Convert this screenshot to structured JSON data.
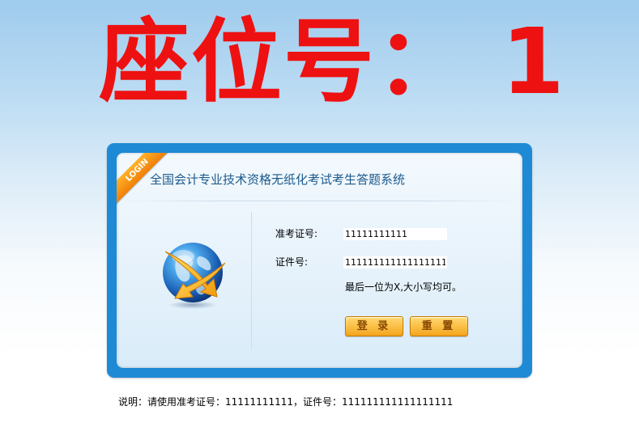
{
  "seat_title": "座位号： 1",
  "panel": {
    "ribbon_label": "LOGIN",
    "system_title": "全国会计专业技术资格无纸化考试考生答题系统",
    "exam_no_label": "准考证号:",
    "exam_no_value": "11111111111",
    "id_no_label": "证件号:",
    "id_no_value": "111111111111111111",
    "hint": "最后一位为X,大小写均可。",
    "login_button": "登 录",
    "reset_button": "重 置"
  },
  "note": "说明：请使用准考证号：11111111111，证件号：111111111111111111",
  "colors": {
    "seat_title": "#ee1111",
    "panel_border": "#1e8ad6",
    "system_title": "#1c5a8c",
    "ribbon": "#f39212",
    "button": "#f7b431"
  },
  "icons": {
    "globe": "globe-with-arrow-icon"
  }
}
